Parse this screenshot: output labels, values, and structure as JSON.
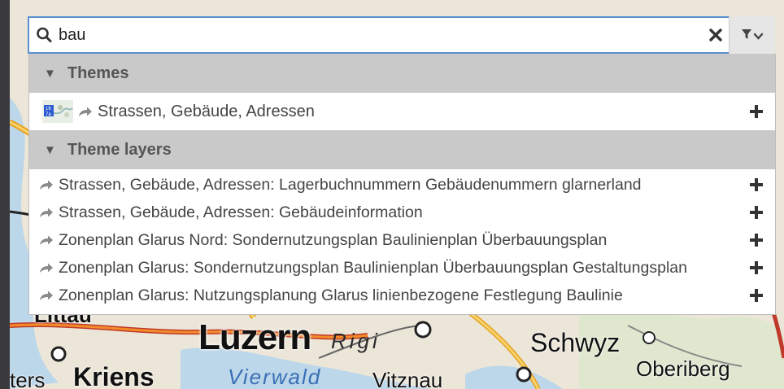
{
  "search": {
    "value": "bau",
    "placeholder": ""
  },
  "icons": {
    "search": "search-icon",
    "clear": "close-icon",
    "filter": "filter-icon",
    "share": "share-arrow-icon",
    "add": "plus-icon",
    "collapse": "triangle-down-icon"
  },
  "themes": {
    "header": "Themes",
    "items": [
      {
        "label": "Strassen, Gebäude, Adressen"
      }
    ]
  },
  "theme_layers": {
    "header": "Theme layers",
    "items": [
      {
        "label": "Strassen, Gebäude, Adressen: Lagerbuchnummern Gebäudenummern glarnerland"
      },
      {
        "label": "Strassen, Gebäude, Adressen: Gebäudeinformation"
      },
      {
        "label": "Zonenplan Glarus Nord: Sondernutzungsplan Baulinienplan Überbauungsplan"
      },
      {
        "label": "Zonenplan Glarus: Sondernutzungsplan Baulinienplan Überbauungsplan Gestaltungsplan"
      },
      {
        "label": "Zonenplan Glarus: Nutzungsplanung Glarus linienbezogene Festlegung Baulinie"
      }
    ]
  },
  "map_labels": {
    "luzern": "Luzern",
    "rigi": "Rigi",
    "schwyz": "Schwyz",
    "oberiberg": "Oberiberg",
    "kriens": "Kriens",
    "vierwald": "Vierwald",
    "vitznau": "Vitznau",
    "littau": "Littau",
    "ters": "ters"
  },
  "colors": {
    "accent_border": "#5b8fd0",
    "section_header_bg": "#c9c9c9",
    "text": "#444444"
  }
}
